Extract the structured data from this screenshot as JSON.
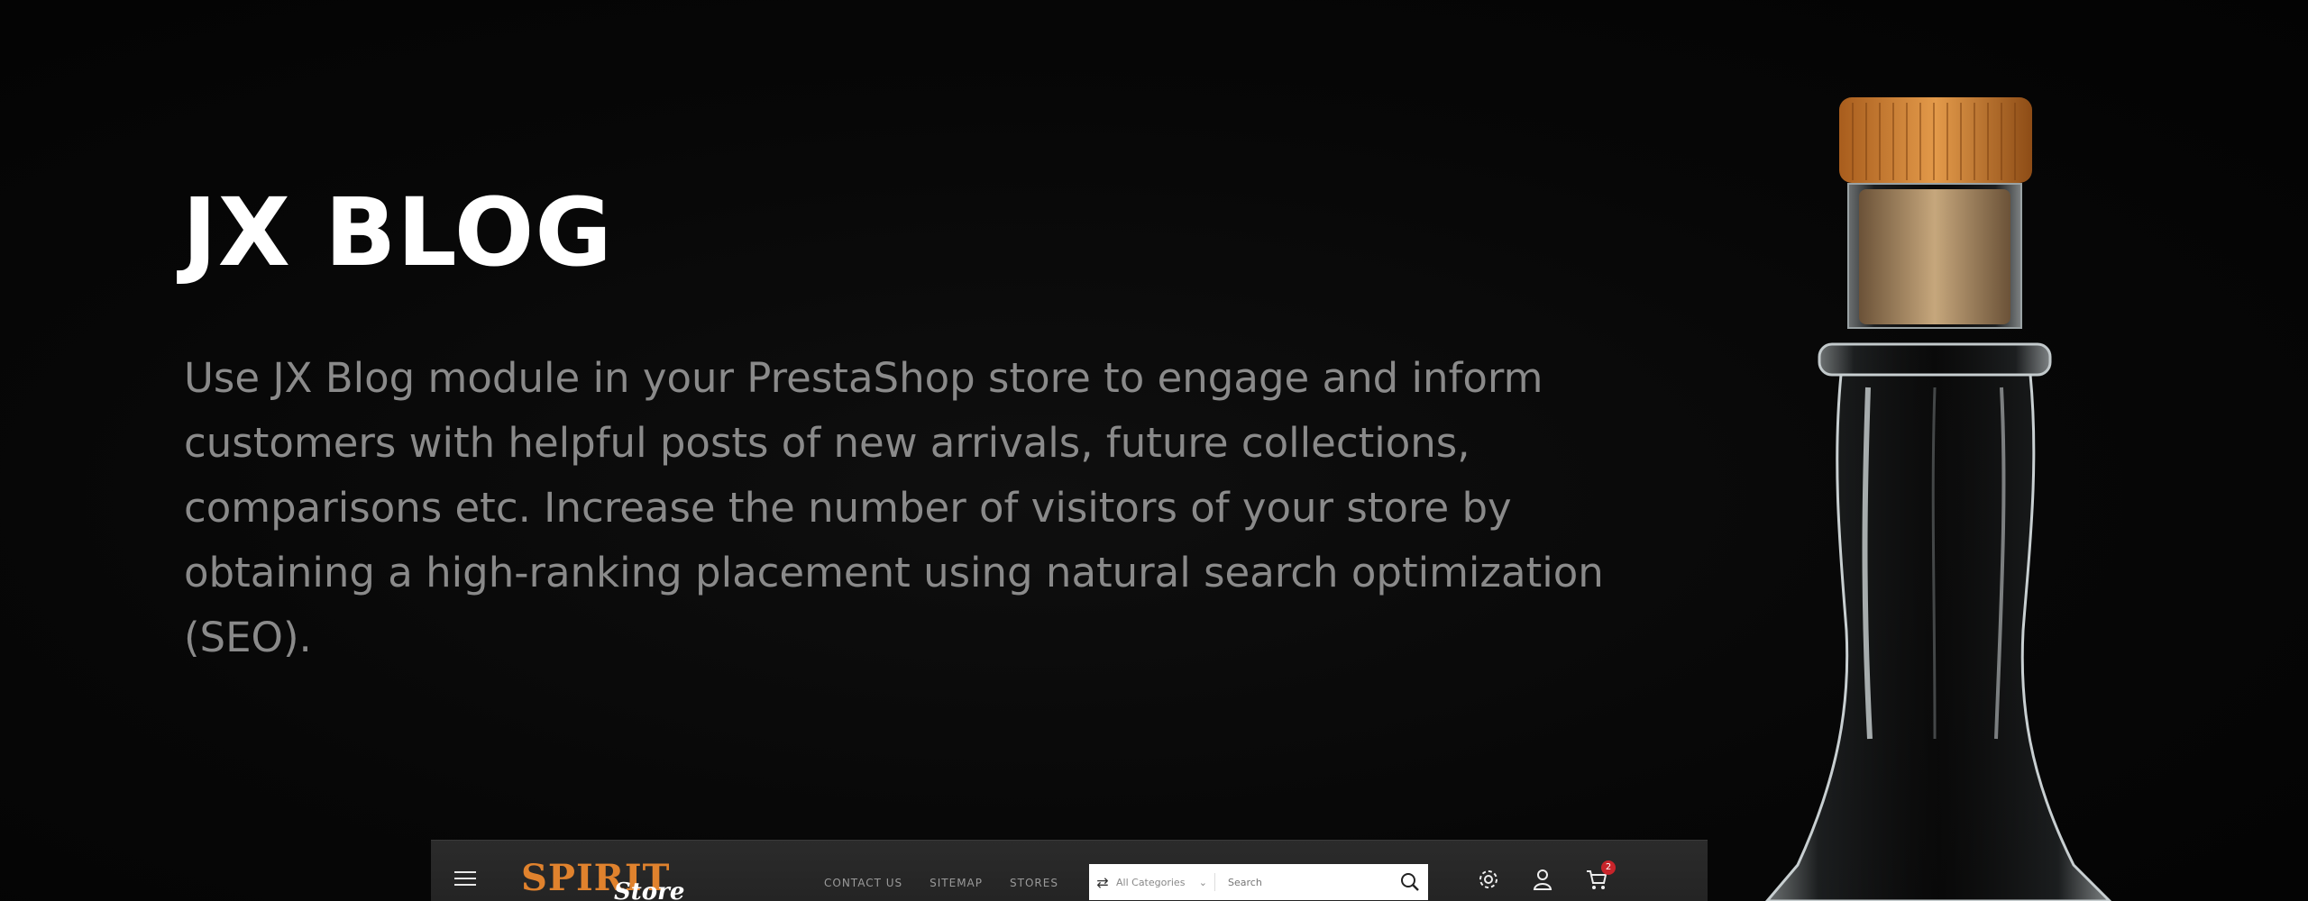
{
  "hero": {
    "title": "JX BLOG",
    "description": "Use JX Blog module in your PrestaShop store to engage and inform customers with helpful posts of new arrivals, future collections, comparisons etc. Increase the number of visitors of your store by obtaining a high-ranking placement using natural search optimization (SEO)."
  },
  "store": {
    "logo_main": "SPIRIT",
    "logo_sub": "Store",
    "nav": [
      "CONTACT US",
      "SITEMAP",
      "STORES"
    ],
    "search": {
      "category": "All Categories",
      "placeholder": "Search"
    },
    "cart_count": "2"
  },
  "colors": {
    "background": "#050505",
    "title": "#ffffff",
    "description": "#8a8a8a",
    "logo": "#e0822d",
    "badge": "#c8242a"
  }
}
